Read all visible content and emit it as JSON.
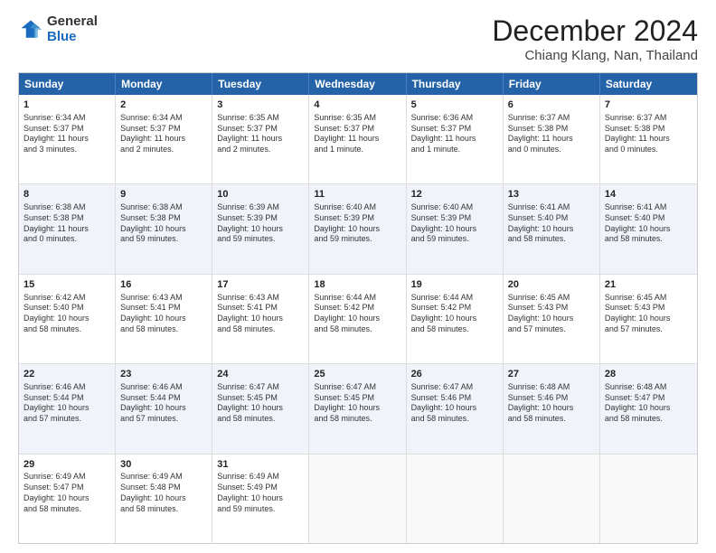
{
  "logo": {
    "general": "General",
    "blue": "Blue"
  },
  "header": {
    "month": "December 2024",
    "location": "Chiang Klang, Nan, Thailand"
  },
  "days": [
    "Sunday",
    "Monday",
    "Tuesday",
    "Wednesday",
    "Thursday",
    "Friday",
    "Saturday"
  ],
  "weeks": [
    [
      {
        "day": "1",
        "info": "Sunrise: 6:34 AM\nSunset: 5:37 PM\nDaylight: 11 hours\nand 3 minutes.",
        "alt": false
      },
      {
        "day": "2",
        "info": "Sunrise: 6:34 AM\nSunset: 5:37 PM\nDaylight: 11 hours\nand 2 minutes.",
        "alt": false
      },
      {
        "day": "3",
        "info": "Sunrise: 6:35 AM\nSunset: 5:37 PM\nDaylight: 11 hours\nand 2 minutes.",
        "alt": false
      },
      {
        "day": "4",
        "info": "Sunrise: 6:35 AM\nSunset: 5:37 PM\nDaylight: 11 hours\nand 1 minute.",
        "alt": false
      },
      {
        "day": "5",
        "info": "Sunrise: 6:36 AM\nSunset: 5:37 PM\nDaylight: 11 hours\nand 1 minute.",
        "alt": false
      },
      {
        "day": "6",
        "info": "Sunrise: 6:37 AM\nSunset: 5:38 PM\nDaylight: 11 hours\nand 0 minutes.",
        "alt": false
      },
      {
        "day": "7",
        "info": "Sunrise: 6:37 AM\nSunset: 5:38 PM\nDaylight: 11 hours\nand 0 minutes.",
        "alt": false
      }
    ],
    [
      {
        "day": "8",
        "info": "Sunrise: 6:38 AM\nSunset: 5:38 PM\nDaylight: 11 hours\nand 0 minutes.",
        "alt": true
      },
      {
        "day": "9",
        "info": "Sunrise: 6:38 AM\nSunset: 5:38 PM\nDaylight: 10 hours\nand 59 minutes.",
        "alt": true
      },
      {
        "day": "10",
        "info": "Sunrise: 6:39 AM\nSunset: 5:39 PM\nDaylight: 10 hours\nand 59 minutes.",
        "alt": true
      },
      {
        "day": "11",
        "info": "Sunrise: 6:40 AM\nSunset: 5:39 PM\nDaylight: 10 hours\nand 59 minutes.",
        "alt": true
      },
      {
        "day": "12",
        "info": "Sunrise: 6:40 AM\nSunset: 5:39 PM\nDaylight: 10 hours\nand 59 minutes.",
        "alt": true
      },
      {
        "day": "13",
        "info": "Sunrise: 6:41 AM\nSunset: 5:40 PM\nDaylight: 10 hours\nand 58 minutes.",
        "alt": true
      },
      {
        "day": "14",
        "info": "Sunrise: 6:41 AM\nSunset: 5:40 PM\nDaylight: 10 hours\nand 58 minutes.",
        "alt": true
      }
    ],
    [
      {
        "day": "15",
        "info": "Sunrise: 6:42 AM\nSunset: 5:40 PM\nDaylight: 10 hours\nand 58 minutes.",
        "alt": false
      },
      {
        "day": "16",
        "info": "Sunrise: 6:43 AM\nSunset: 5:41 PM\nDaylight: 10 hours\nand 58 minutes.",
        "alt": false
      },
      {
        "day": "17",
        "info": "Sunrise: 6:43 AM\nSunset: 5:41 PM\nDaylight: 10 hours\nand 58 minutes.",
        "alt": false
      },
      {
        "day": "18",
        "info": "Sunrise: 6:44 AM\nSunset: 5:42 PM\nDaylight: 10 hours\nand 58 minutes.",
        "alt": false
      },
      {
        "day": "19",
        "info": "Sunrise: 6:44 AM\nSunset: 5:42 PM\nDaylight: 10 hours\nand 58 minutes.",
        "alt": false
      },
      {
        "day": "20",
        "info": "Sunrise: 6:45 AM\nSunset: 5:43 PM\nDaylight: 10 hours\nand 57 minutes.",
        "alt": false
      },
      {
        "day": "21",
        "info": "Sunrise: 6:45 AM\nSunset: 5:43 PM\nDaylight: 10 hours\nand 57 minutes.",
        "alt": false
      }
    ],
    [
      {
        "day": "22",
        "info": "Sunrise: 6:46 AM\nSunset: 5:44 PM\nDaylight: 10 hours\nand 57 minutes.",
        "alt": true
      },
      {
        "day": "23",
        "info": "Sunrise: 6:46 AM\nSunset: 5:44 PM\nDaylight: 10 hours\nand 57 minutes.",
        "alt": true
      },
      {
        "day": "24",
        "info": "Sunrise: 6:47 AM\nSunset: 5:45 PM\nDaylight: 10 hours\nand 58 minutes.",
        "alt": true
      },
      {
        "day": "25",
        "info": "Sunrise: 6:47 AM\nSunset: 5:45 PM\nDaylight: 10 hours\nand 58 minutes.",
        "alt": true
      },
      {
        "day": "26",
        "info": "Sunrise: 6:47 AM\nSunset: 5:46 PM\nDaylight: 10 hours\nand 58 minutes.",
        "alt": true
      },
      {
        "day": "27",
        "info": "Sunrise: 6:48 AM\nSunset: 5:46 PM\nDaylight: 10 hours\nand 58 minutes.",
        "alt": true
      },
      {
        "day": "28",
        "info": "Sunrise: 6:48 AM\nSunset: 5:47 PM\nDaylight: 10 hours\nand 58 minutes.",
        "alt": true
      }
    ],
    [
      {
        "day": "29",
        "info": "Sunrise: 6:49 AM\nSunset: 5:47 PM\nDaylight: 10 hours\nand 58 minutes.",
        "alt": false
      },
      {
        "day": "30",
        "info": "Sunrise: 6:49 AM\nSunset: 5:48 PM\nDaylight: 10 hours\nand 58 minutes.",
        "alt": false
      },
      {
        "day": "31",
        "info": "Sunrise: 6:49 AM\nSunset: 5:49 PM\nDaylight: 10 hours\nand 59 minutes.",
        "alt": false
      },
      {
        "day": "",
        "info": "",
        "alt": false,
        "empty": true
      },
      {
        "day": "",
        "info": "",
        "alt": false,
        "empty": true
      },
      {
        "day": "",
        "info": "",
        "alt": false,
        "empty": true
      },
      {
        "day": "",
        "info": "",
        "alt": false,
        "empty": true
      }
    ]
  ]
}
